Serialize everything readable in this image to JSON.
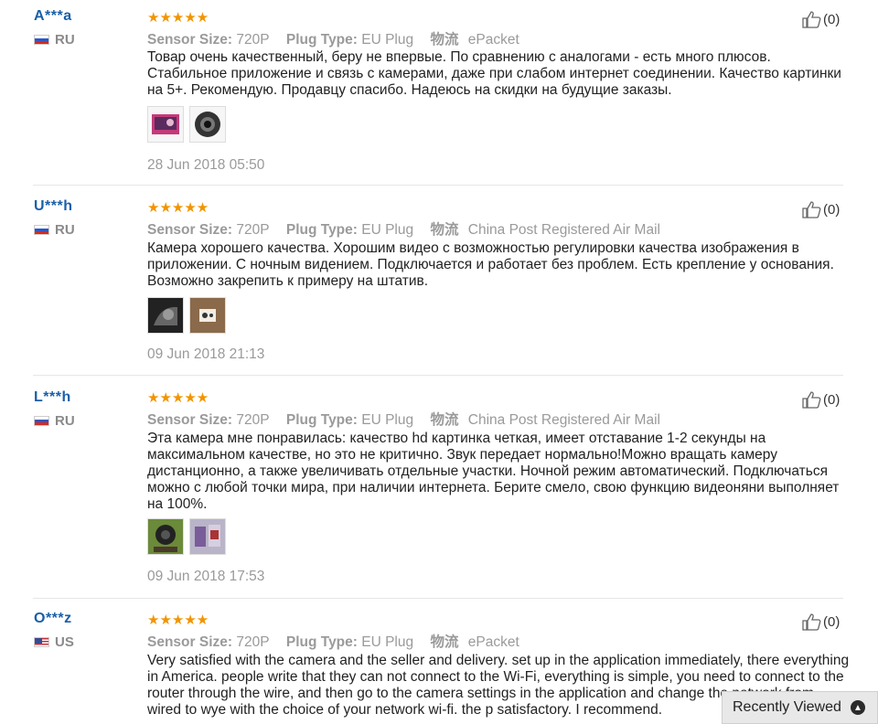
{
  "labels": {
    "sensor": "Sensor Size:",
    "plug": "Plug Type:",
    "shipping": "物流"
  },
  "reviews": [
    {
      "user": "A***a",
      "country": "RU",
      "stars": "★★★★★",
      "sensor": "720P",
      "plug": "EU Plug",
      "shipping": "ePacket",
      "likes": "(0)",
      "text": "Товар очень качественный, беру не впервые. По сравнению с аналогами - есть много плюсов. Стабильное приложение и связь с камерами, даже при слабом интернет соединении. Качество картинки на 5+. Рекомендую. Продавцу спасибо. Надеюсь на скидки на будущие заказы.",
      "date": "28 Jun 2018 05:50"
    },
    {
      "user": "U***h",
      "country": "RU",
      "stars": "★★★★★",
      "sensor": "720P",
      "plug": "EU Plug",
      "shipping": "China Post Registered Air Mail",
      "likes": "(0)",
      "text": "Камера хорошего качества. Хорошим видео с возможностью регулировки качества изображения в приложении. С ночным видением. Подключается и работает без проблем. Есть крепление у основания. Возможно закрепить к примеру на штатив.",
      "date": "09 Jun 2018 21:13"
    },
    {
      "user": "L***h",
      "country": "RU",
      "stars": "★★★★★",
      "sensor": "720P",
      "plug": "EU Plug",
      "shipping": "China Post Registered Air Mail",
      "likes": "(0)",
      "text": "Эта камера мне понравилась: качество hd картинка четкая, имеет отставание 1-2 секунды на максимальном качестве, но это не критично. Звук передает нормально!Можно вращать камеру дистанционно, а также увеличивать отдельные участки. Ночной режим автоматический. Подключаться можно с любой точки мира, при наличии интернета. Берите смело, свою функцию видеоняни выполняет на 100%.",
      "date": "09 Jun 2018 17:53"
    },
    {
      "user": "O***z",
      "country": "US",
      "stars": "★★★★★",
      "sensor": "720P",
      "plug": "EU Plug",
      "shipping": "ePacket",
      "likes": "(0)",
      "text": "Very satisfied with the camera and the seller and delivery. set up in the application immediately, there everything in America. people write that they can not connect to the Wi-Fi, everything is simple, you need to connect to the router through the wire, and then go to the camera settings in the application and change the network from wired to wye with the choice of your network wi-fi. the p satisfactory. I recommend."
    }
  ],
  "recently_viewed": {
    "label": "Recently Viewed",
    "icon": "chevron-up-icon"
  }
}
